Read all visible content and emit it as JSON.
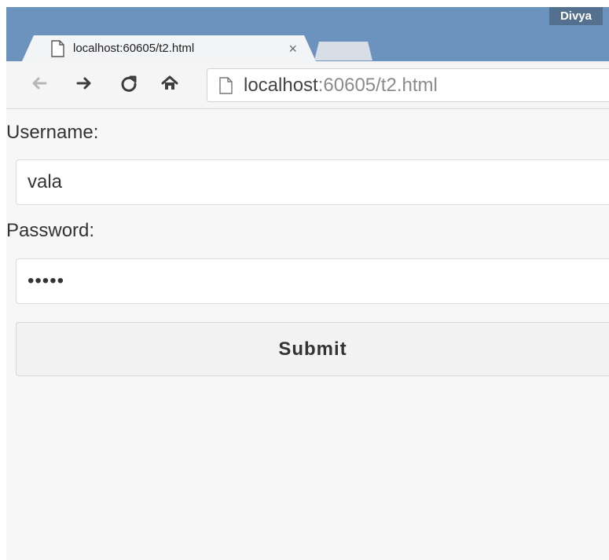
{
  "browser": {
    "profile_name": "Divya",
    "tab": {
      "title": "localhost:60605/t2.html",
      "close": "×"
    },
    "address_bar": {
      "host": "localhost",
      "rest": ":60605/t2.html"
    },
    "icons": {
      "tab": "page-icon",
      "back": "back-icon",
      "forward": "forward-icon",
      "reload": "reload-icon",
      "home": "home-icon",
      "address": "page-icon"
    }
  },
  "form": {
    "username_label": "Username:",
    "username_value": "vala",
    "password_label": "Password:",
    "password_value": "•••••",
    "submit_label": "Submit"
  },
  "colors": {
    "frame": "#6b93bd",
    "profile_badge": "#54708f",
    "toolbar": "#f5f5f5",
    "content": "#f7f7f7"
  }
}
